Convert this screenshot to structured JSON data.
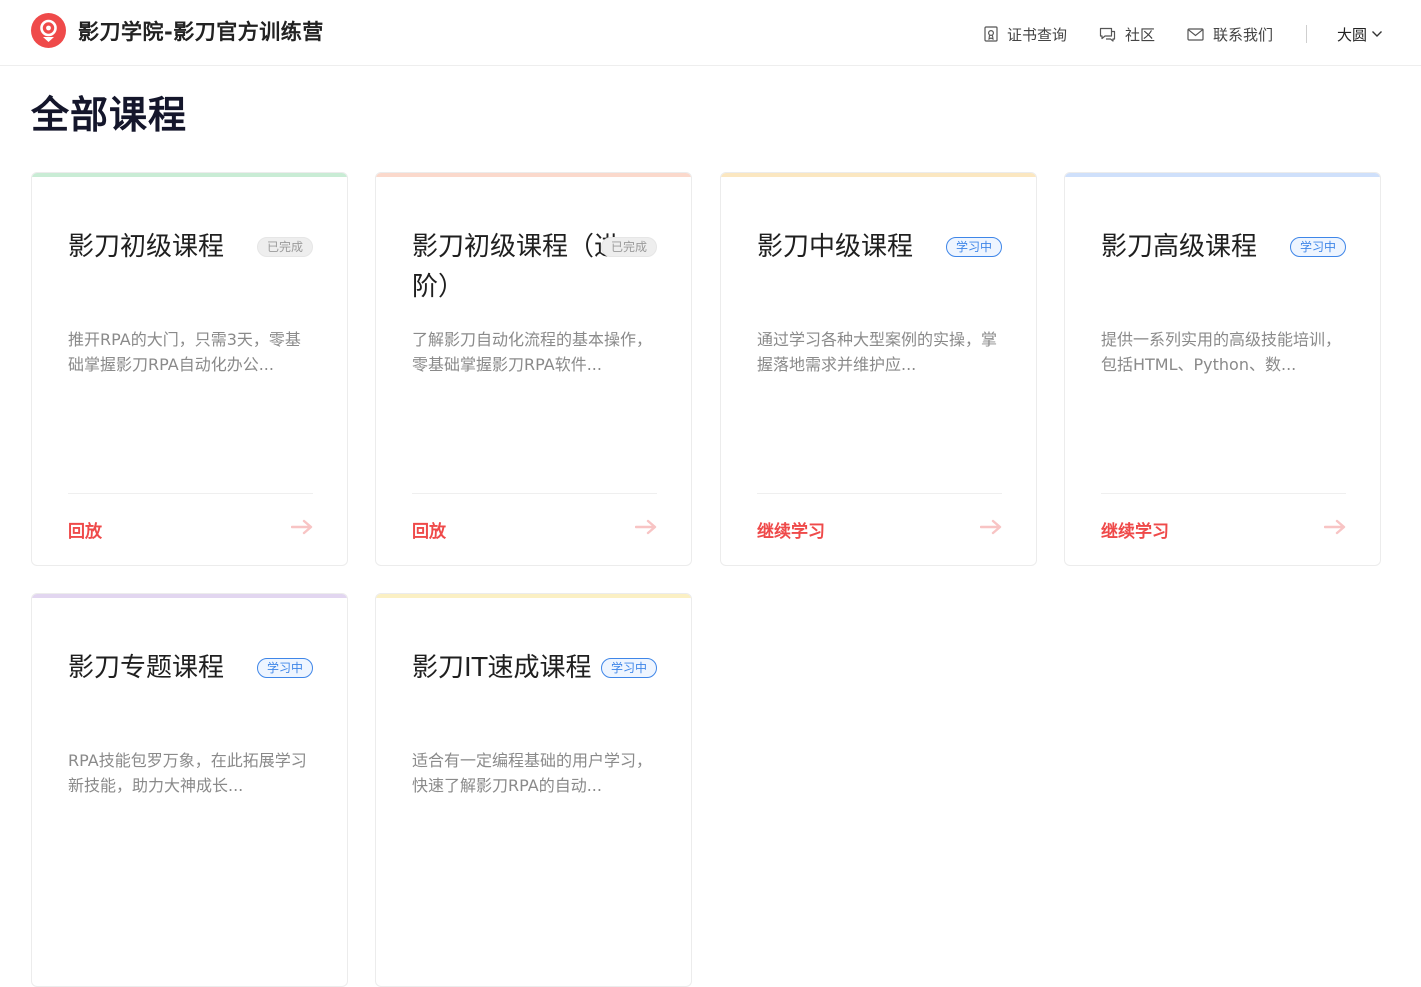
{
  "header": {
    "brand_title": "影刀学院-影刀官方训练营",
    "nav": [
      {
        "label": "证书查询",
        "icon": "certificate-icon"
      },
      {
        "label": "社区",
        "icon": "chat-bubble-icon"
      },
      {
        "label": "联系我们",
        "icon": "mail-icon"
      }
    ],
    "user_name": "大圆"
  },
  "page": {
    "title": "全部课程"
  },
  "colors": {
    "brand": "#ef4a4a",
    "tag_learning": "#3f86e8",
    "accent_green": "#c9ecd5",
    "accent_peach": "#fbd9cc",
    "accent_yellow": "#fbe7c1",
    "accent_blue": "#cfe0fb",
    "accent_purple": "#e2d6f0",
    "accent_lightyellow": "#fbf0c4"
  },
  "courses": [
    {
      "title": "影刀初级课程",
      "tag": "已完成",
      "desc": "推开RPA的大门，只需3天，零基础掌握影刀RPA自动化办公...",
      "action": "回放"
    },
    {
      "title": "影刀初级课程（进阶）",
      "tag": "已完成",
      "desc": "了解影刀自动化流程的基本操作，零基础掌握影刀RPA软件...",
      "action": "回放"
    },
    {
      "title": "影刀中级课程",
      "tag": "学习中",
      "desc": "通过学习各种大型案例的实操，掌握落地需求并维护应...",
      "action": "继续学习"
    },
    {
      "title": "影刀高级课程",
      "tag": "学习中",
      "desc": "提供一系列实用的高级技能培训，包括HTML、Python、数...",
      "action": "继续学习"
    },
    {
      "title": "影刀专题课程",
      "tag": "学习中",
      "desc": "RPA技能包罗万象，在此拓展学习新技能，助力大神成长...",
      "action": ""
    },
    {
      "title": "影刀IT速成课程",
      "tag": "学习中",
      "desc": "适合有一定编程基础的用户学习，快速了解影刀RPA的自动...",
      "action": ""
    }
  ]
}
